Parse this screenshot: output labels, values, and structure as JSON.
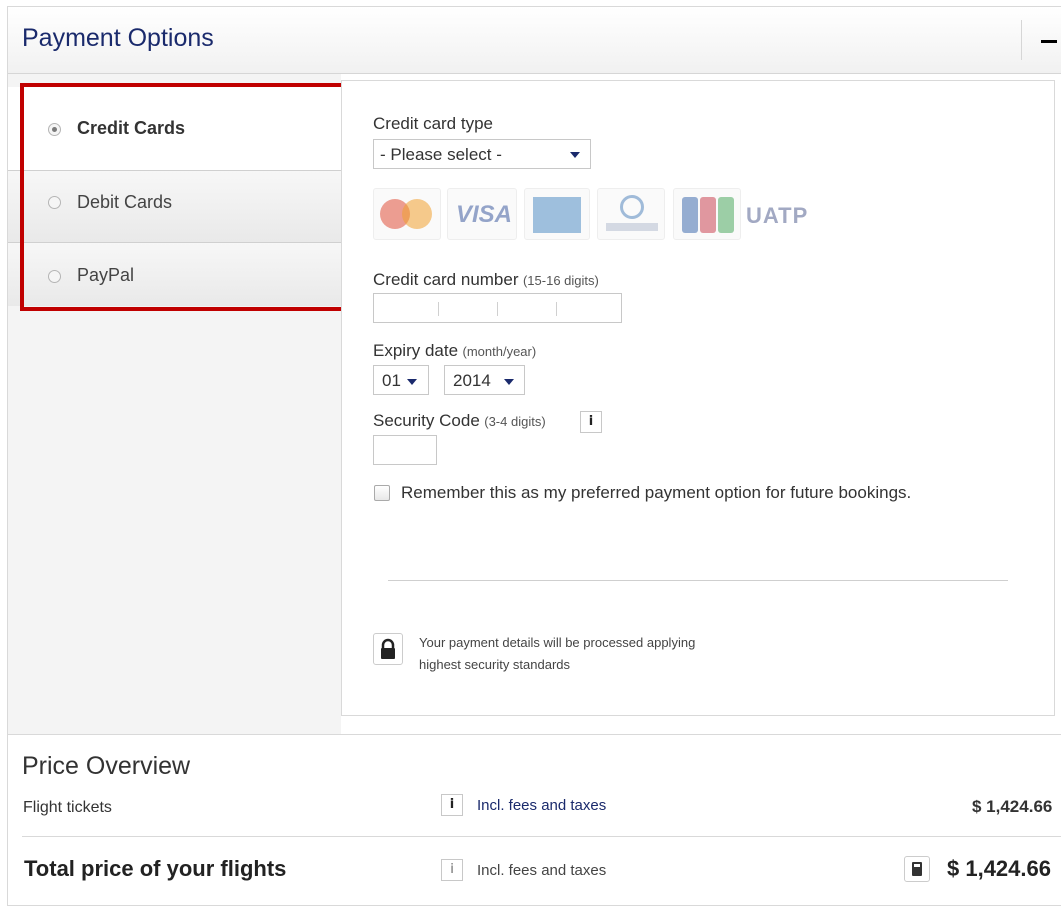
{
  "header": {
    "title": "Payment Options",
    "collapse_icon": "minus-icon"
  },
  "payment_methods": [
    {
      "label": "Credit Cards",
      "selected": true
    },
    {
      "label": "Debit Cards",
      "selected": false
    },
    {
      "label": "PayPal",
      "selected": false
    }
  ],
  "form": {
    "card_type_label": "Credit card type",
    "card_type_value": "- Please select -",
    "card_brands": [
      "MasterCard",
      "VISA",
      "American Express",
      "Diners Club International",
      "JCB",
      "UATP"
    ],
    "card_number_label": "Credit card number",
    "card_number_hint": "(15-16 digits)",
    "expiry_label": "Expiry date",
    "expiry_hint": "(month/year)",
    "expiry_month": "01",
    "expiry_year": "2014",
    "security_label": "Security Code",
    "security_hint": "(3-4 digits)",
    "info_glyph": "i",
    "remember_label": "Remember this as my preferred payment option for future bookings.",
    "remember_checked": false,
    "security_note_line1": "Your payment details will be processed applying",
    "security_note_line2": "highest security standards"
  },
  "price_overview": {
    "title": "Price Overview",
    "rows": [
      {
        "label": "Flight tickets",
        "note": "Incl. fees and taxes",
        "amount": "$ 1,424.66"
      },
      {
        "label": "Total price of your flights",
        "note": "Incl. fees and taxes",
        "amount": "$ 1,424.66"
      }
    ]
  },
  "colors": {
    "accent": "#1a2a6c",
    "highlight": "#c00000",
    "visa": "#1a3d8f",
    "mastercard_red": "#e0503a",
    "mastercard_orange": "#f0a030"
  }
}
